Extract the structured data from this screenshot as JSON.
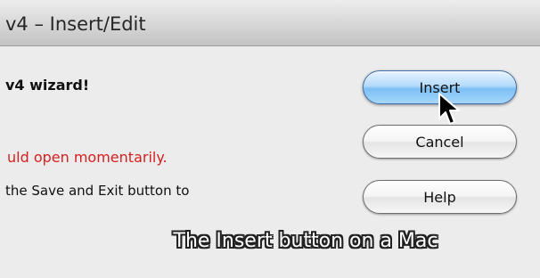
{
  "window": {
    "title": "v4 – Insert/Edit"
  },
  "content": {
    "welcome": "v4 wizard!",
    "warning": "uld open momentarily.",
    "instruction": "the Save and Exit button to"
  },
  "buttons": {
    "insert": "Insert",
    "cancel": "Cancel",
    "help": "Help"
  },
  "overlay": {
    "caption": "The Insert button on a Mac"
  },
  "icons": {
    "cursor": "mouse-pointer-icon"
  },
  "colors": {
    "warning_text": "#d61f1f",
    "default_button": "#7cc0f5"
  }
}
